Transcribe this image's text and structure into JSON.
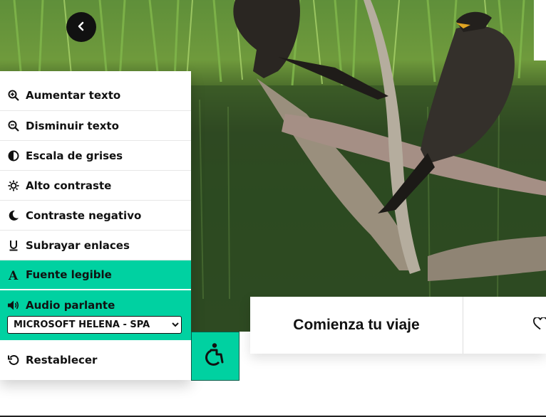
{
  "accessibility_menu": {
    "items": [
      {
        "label": "Aumentar texto",
        "icon": "zoom-in-icon"
      },
      {
        "label": "Disminuir texto",
        "icon": "zoom-out-icon"
      },
      {
        "label": "Escala de grises",
        "icon": "grayscale-icon"
      },
      {
        "label": "Alto contraste",
        "icon": "brightness-icon"
      },
      {
        "label": "Contraste negativo",
        "icon": "moon-icon"
      },
      {
        "label": "Subrayar enlaces",
        "icon": "underline-icon"
      },
      {
        "label": "Fuente legible",
        "icon": "font-icon",
        "active": true
      },
      {
        "label": "Audio parlante",
        "icon": "speaker-icon",
        "active": true
      },
      {
        "label": "Restablecer",
        "icon": "reset-icon"
      }
    ],
    "voice_select": {
      "selected": "MICROSOFT HELENA - SPA"
    },
    "toggle_icon": "wheelchair-icon"
  },
  "navigation": {
    "back_icon": "chevron-left-icon"
  },
  "cta": {
    "primary_label": "Comienza tu viaje",
    "secondary_icon": "heart-icon"
  },
  "colors": {
    "accent": "#00d1a1",
    "text": "#111111",
    "panel_bg": "#ffffff"
  }
}
